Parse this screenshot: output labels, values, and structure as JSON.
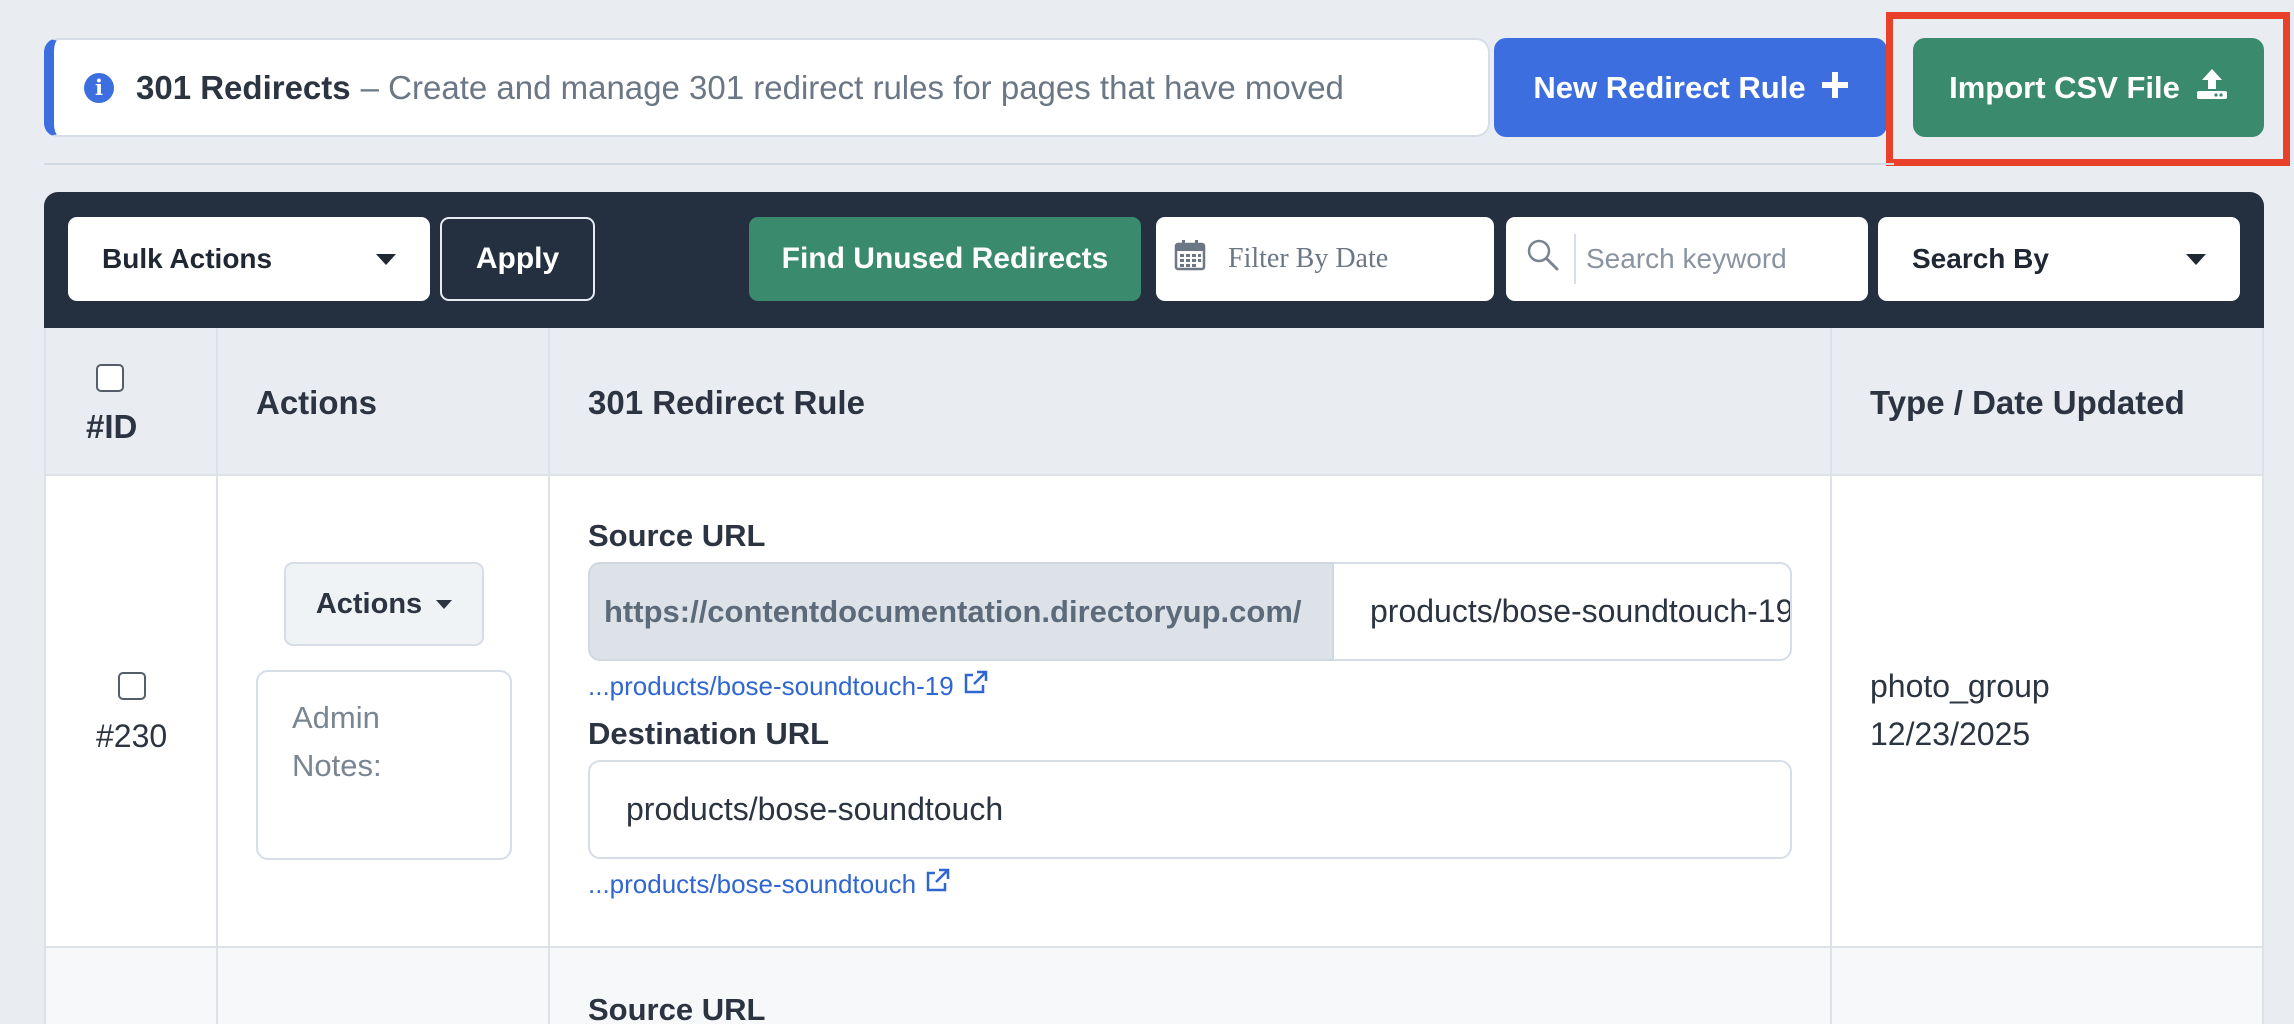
{
  "banner": {
    "title": "301 Redirects",
    "description": "– Create and manage 301 redirect rules for pages that have moved"
  },
  "buttons": {
    "new_rule": "New Redirect Rule",
    "import_csv": "Import CSV File"
  },
  "toolbar": {
    "bulk_actions": "Bulk Actions",
    "apply": "Apply",
    "find_unused": "Find Unused Redirects",
    "filter_date_placeholder": "Filter By Date",
    "search_placeholder": "Search keyword",
    "search_by": "Search By"
  },
  "table": {
    "columns": {
      "id": "#ID",
      "actions": "Actions",
      "rule": "301 Redirect Rule",
      "type_date": "Type / Date Updated"
    },
    "rows": [
      {
        "id": "#230",
        "actions_label": "Actions",
        "notes_placeholder": "Admin Notes:",
        "source_label": "Source URL",
        "source_prefix": "https://contentdocumentation.directoryup.com/",
        "source_value": "products/bose-soundtouch-19",
        "source_link": "...products/bose-soundtouch-19",
        "destination_label": "Destination URL",
        "destination_value": "products/bose-soundtouch",
        "destination_link": "...products/bose-soundtouch",
        "type": "photo_group",
        "date": "12/23/2025"
      },
      {
        "source_label": "Source URL"
      }
    ]
  },
  "icons": {
    "info": "info-icon",
    "plus": "plus-icon",
    "upload": "upload-icon",
    "calendar": "calendar-icon",
    "search": "search-icon",
    "external_link": "external-link-icon"
  },
  "colors": {
    "primary_blue": "#3d6ee0",
    "green": "#3a8a6e",
    "toolbar_dark": "#243040",
    "highlight_red": "#e8402b",
    "link_blue": "#2f66d0"
  }
}
